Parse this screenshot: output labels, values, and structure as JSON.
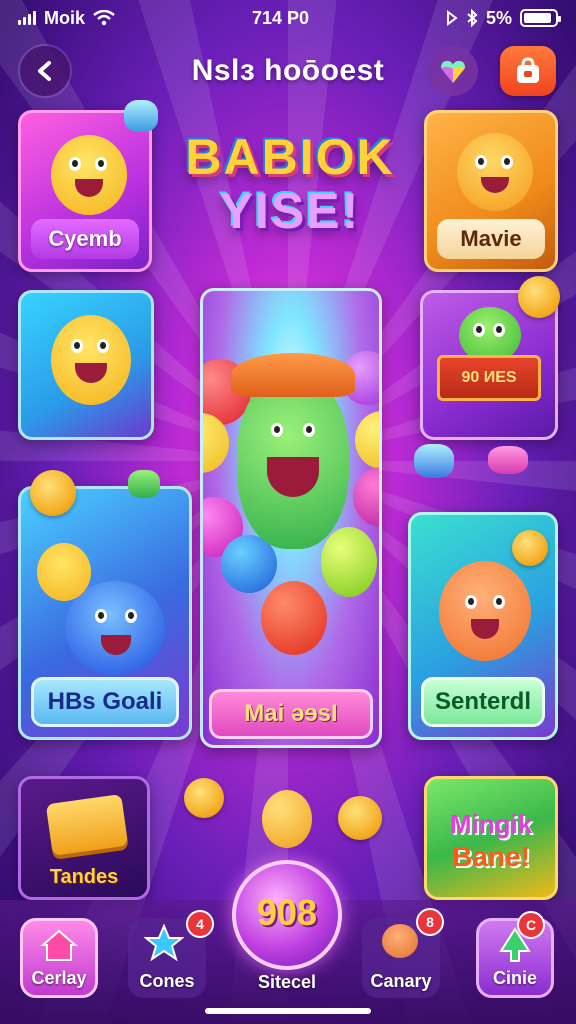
{
  "status_bar": {
    "carrier": "Moik",
    "time": "714 P0",
    "battery": "5%",
    "battery_level": 0.9
  },
  "header": {
    "title": "Nslɜ hoōoest"
  },
  "hero": {
    "line1": "BABIOK",
    "line2": "YISE!"
  },
  "cards": {
    "top_left": {
      "label": "Cyemb"
    },
    "top_right": {
      "label": "Mavie"
    },
    "mid_right": {
      "crate_text": "90 ИEЅ"
    },
    "bottom_left": {
      "label": "HBs Goali"
    },
    "center": {
      "label": "Mai ǝɘsI"
    },
    "bottom_right": {
      "label": "Senterdl"
    },
    "tiny_left": {
      "label": "Tandes"
    },
    "tiny_right": {
      "line1": "Mingik",
      "line2": "Bane!"
    }
  },
  "nav": {
    "items": [
      {
        "label": "Cerlay"
      },
      {
        "label": "Cones",
        "badge": "4"
      },
      {
        "label": "Sitecel",
        "value": "908"
      },
      {
        "label": "Canary",
        "badge": "8"
      },
      {
        "label": "Cinie",
        "badge": "C"
      }
    ]
  },
  "colors": {
    "background": "#6a1fb8",
    "accent_orange": "#f0431f",
    "gold": "#f2a81c",
    "label_green": "#1fb84a"
  },
  "icons": [
    "back-arrow-icon",
    "gem-icon",
    "bag-icon",
    "home-icon",
    "star-icon",
    "bear-icon",
    "tree-icon"
  ]
}
